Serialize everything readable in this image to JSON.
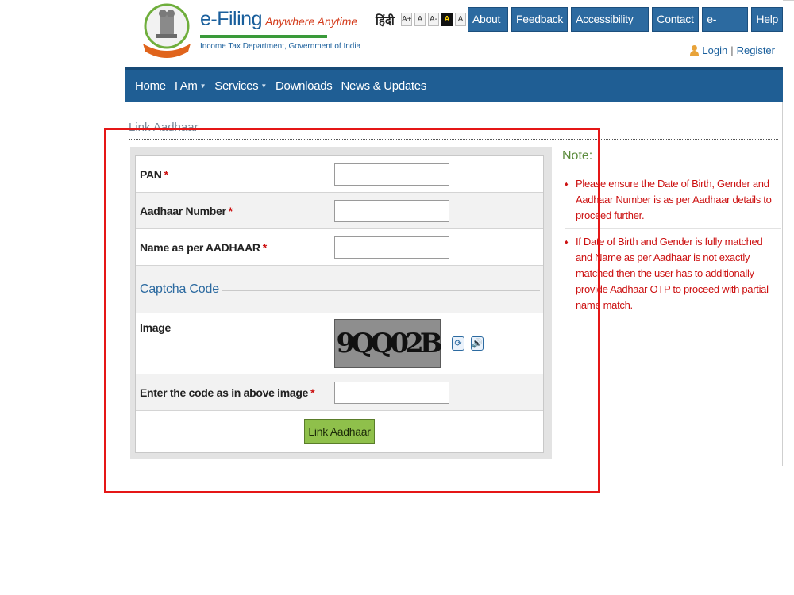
{
  "header": {
    "logo_title": "e-Filing",
    "logo_tagline": "Anywhere Anytime",
    "logo_subtitle": "Income Tax Department, Government of India",
    "lang_label": "हिंदी",
    "font_sizes": [
      "A+",
      "A",
      "A-",
      "A",
      "A"
    ],
    "top_nav": [
      "About Us",
      "Feedback",
      "Accessibility Options",
      "Contact Us",
      "e-Nivaran",
      "Help"
    ],
    "login_label": "Login",
    "separator": "|",
    "register_label": "Register"
  },
  "main_nav": {
    "items": [
      "Home",
      "I Am",
      "Services",
      "Downloads",
      "News & Updates"
    ]
  },
  "page": {
    "title": "Link Aadhaar"
  },
  "form": {
    "pan_label": "PAN",
    "aadhaar_label": "Aadhaar Number",
    "name_label": "Name as per AADHAAR",
    "required_mark": "*",
    "captcha_section": "Captcha Code",
    "image_label": "Image",
    "captcha_text": "9QQ02B",
    "code_label": "Enter the code as in above image",
    "submit_label": "Link Aadhaar",
    "pan_value": "",
    "aadhaar_value": "",
    "name_value": "",
    "code_value": ""
  },
  "note": {
    "title": "Note:",
    "items": [
      "Please ensure the Date of Birth, Gender and Aadhaar Number is as per Aadhaar details to proceed further.",
      "If Date of Birth and Gender is fully matched and Name as per Aadhaar is not exactly matched then the user has to additionally provide Aadhaar OTP to proceed with partial name match."
    ]
  },
  "colors": {
    "nav_bg": "#1f5e94",
    "button_blue": "#2c6aa0",
    "submit_green": "#8fc04b",
    "note_red": "#cc1111",
    "highlight": "#e51717"
  }
}
